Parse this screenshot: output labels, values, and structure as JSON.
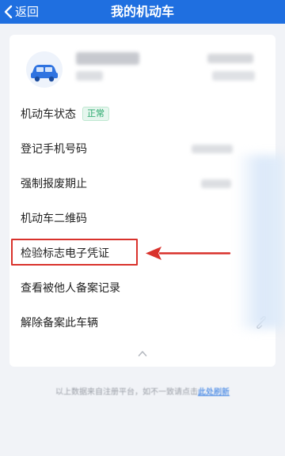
{
  "header": {
    "back_label": "返回",
    "title": "我的机动车",
    "bg_color": "#1f6fe0"
  },
  "vehicle": {
    "icon": "car-icon"
  },
  "rows": [
    {
      "label": "机动车状态",
      "badge": "正常"
    },
    {
      "label": "登记手机号码"
    },
    {
      "label": "强制报废期止"
    },
    {
      "label": "机动车二维码"
    },
    {
      "label": "检验标志电子凭证"
    },
    {
      "label": "查看被他人备案记录"
    },
    {
      "label": "解除备案此车辆",
      "icon": "unlink-icon"
    }
  ],
  "annotation": {
    "highlight_color": "#d9322c",
    "arrow_icon": "arrow-left-icon"
  },
  "collapse_icon": "chevron-up-icon",
  "footer": {
    "note": "以上数据来自注册平台，如不一致请点击",
    "link": "此处刷新"
  }
}
